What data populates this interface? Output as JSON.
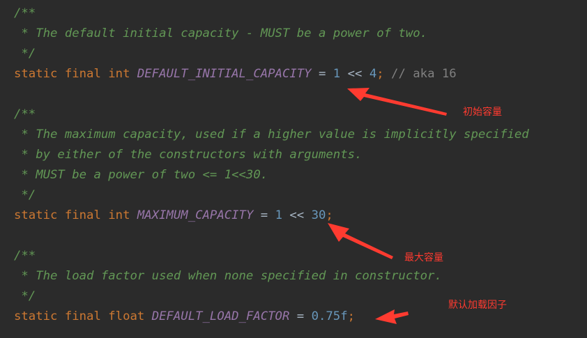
{
  "editor": {
    "colors": {
      "background": "#2b2b2b",
      "comment": "#629755",
      "keyword": "#cc7832",
      "field": "#9876aa",
      "number": "#6897bb",
      "operator": "#a9b7c6",
      "line_comment": "#808080",
      "annotation": "#ff3b30"
    },
    "block1": {
      "comment_open": "/**",
      "comment_text": " * The default initial capacity - MUST be a power of two.",
      "comment_close": " */",
      "decl": {
        "modifiers": "static final int",
        "name": "DEFAULT_INITIAL_CAPACITY",
        "eq": " = ",
        "lhs": "1",
        "shift": " << ",
        "rhs": "4",
        "semicolon": ";",
        "line_comment": " // aka 16"
      }
    },
    "block2": {
      "comment_open": "/**",
      "comment_lines": [
        " * The maximum capacity, used if a higher value is implicitly specified",
        " * by either of the constructors with arguments.",
        " * MUST be a power of two <= 1<<30."
      ],
      "comment_close": " */",
      "decl": {
        "modifiers": "static final int",
        "name": "MAXIMUM_CAPACITY",
        "eq": " = ",
        "lhs": "1",
        "shift": " << ",
        "rhs": "30",
        "semicolon": ";"
      }
    },
    "block3": {
      "comment_open": "/**",
      "comment_text": " * The load factor used when none specified in constructor.",
      "comment_close": " */",
      "decl": {
        "modifiers": "static final float",
        "name": "DEFAULT_LOAD_FACTOR",
        "eq": " = ",
        "value": "0.75f",
        "semicolon": ";"
      }
    }
  },
  "annotations": {
    "initial_capacity": "初始容量",
    "maximum_capacity": "最大容量",
    "default_load_factor": "默认加载因子"
  }
}
